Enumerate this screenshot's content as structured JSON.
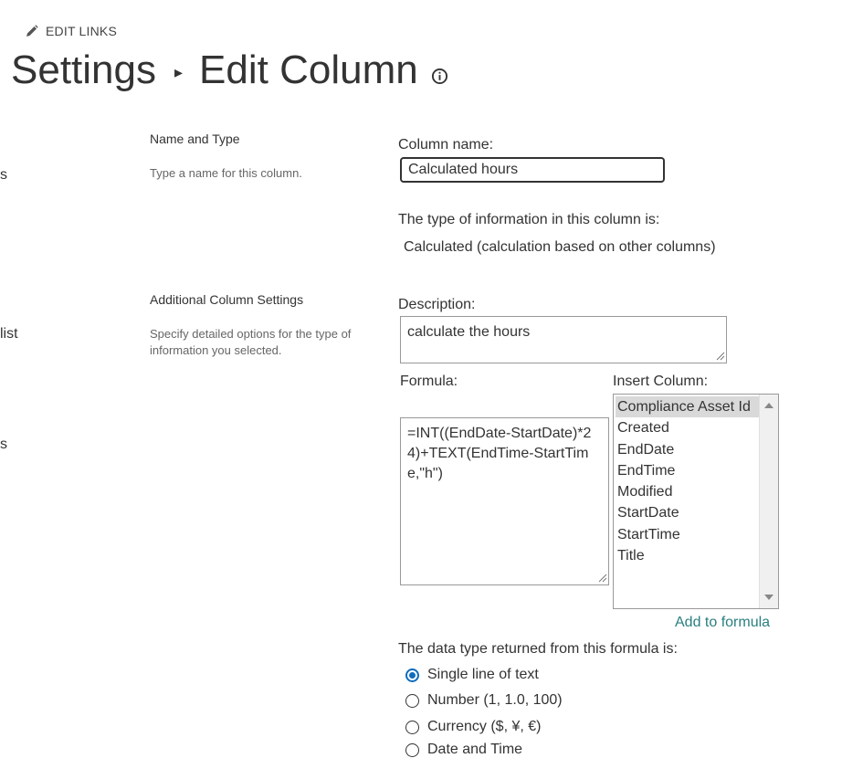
{
  "toolbar": {
    "edit_links_label": "EDIT LINKS",
    "edit_icon": "pencil-icon"
  },
  "breadcrumb": {
    "parent": "Settings",
    "separator": "▸",
    "current": "Edit Column",
    "info_icon": "info-icon"
  },
  "left_nav_fragments": [
    "s",
    "list",
    "s"
  ],
  "sections": {
    "name_type": {
      "title": "Name and Type",
      "description": "Type a name for this column."
    },
    "additional": {
      "title": "Additional Column Settings",
      "description": "Specify detailed options for the type of information you selected."
    }
  },
  "form": {
    "column_name_label": "Column name:",
    "column_name_value": "Calculated hours",
    "type_info_label": "The type of information in this column is:",
    "type_value": "Calculated (calculation based on other columns)",
    "description_label": "Description:",
    "description_value": "calculate the hours",
    "formula_label": "Formula:",
    "formula_value": "=INT((EndDate-StartDate)*24)+TEXT(EndTime-StartTime,\"h\")",
    "insert_column_label": "Insert Column:",
    "insert_columns": [
      "Compliance Asset Id",
      "Created",
      "EndDate",
      "EndTime",
      "Modified",
      "StartDate",
      "StartTime",
      "Title"
    ],
    "insert_selected": "Compliance Asset Id",
    "add_to_formula_label": "Add to formula",
    "return_type_label": "The data type returned from this formula is:",
    "return_types": [
      {
        "label": "Single line of text",
        "checked": true
      },
      {
        "label": "Number (1, 1.0, 100)",
        "checked": false
      },
      {
        "label": "Currency ($, ¥, €)",
        "checked": false
      },
      {
        "label": "Date and Time",
        "checked": false
      }
    ]
  },
  "colors": {
    "accent": "#0f6cbd",
    "link": "#2a7f7f",
    "text": "#333333"
  }
}
